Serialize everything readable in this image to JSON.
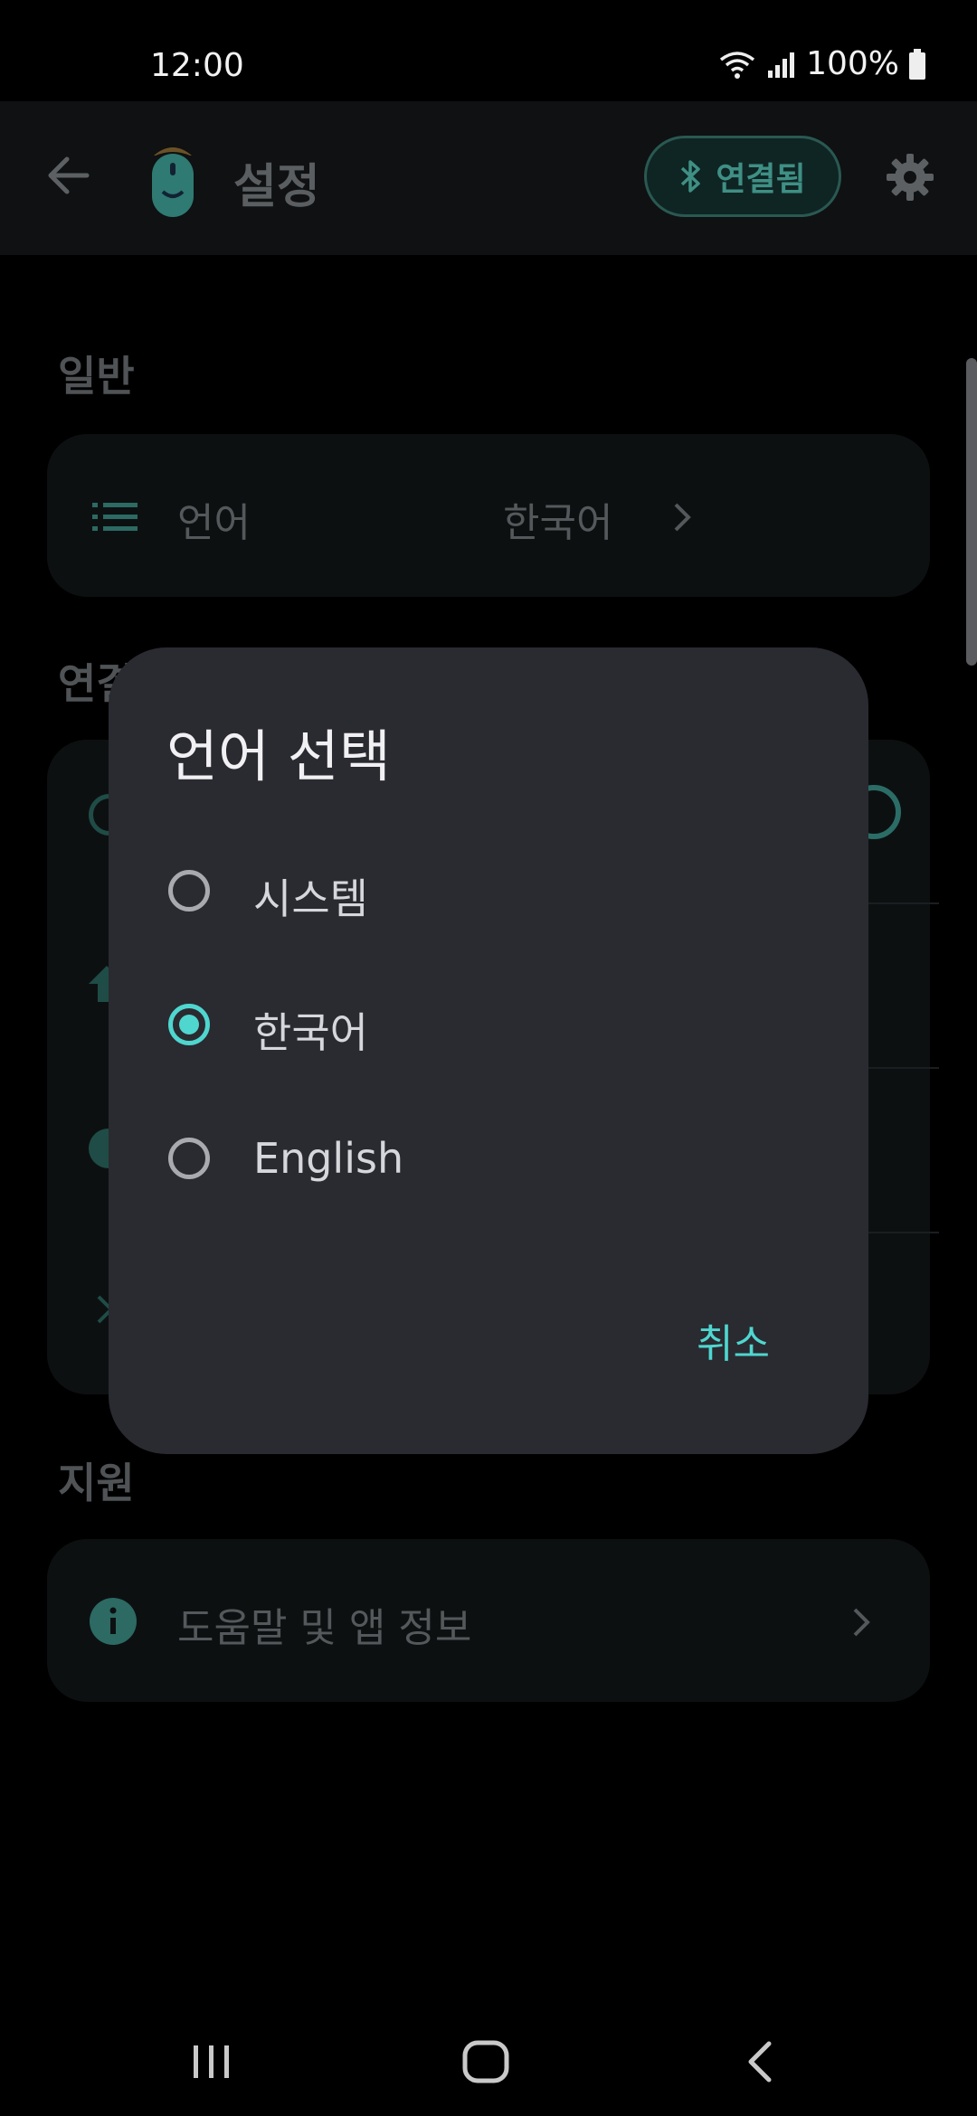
{
  "status_bar": {
    "time": "12:00",
    "battery": "100%"
  },
  "app_bar": {
    "title": "설정",
    "connection_label": "연결됨"
  },
  "sections": {
    "general": {
      "header": "일반",
      "language_label": "언어",
      "language_value": "한국어"
    },
    "connection": {
      "header": "연결"
    },
    "support": {
      "header": "지원",
      "help_label": "도움말 및 앱 정보"
    }
  },
  "dialog": {
    "title": "언어 선택",
    "options": [
      {
        "label": "시스템",
        "selected": false
      },
      {
        "label": "한국어",
        "selected": true
      },
      {
        "label": "English",
        "selected": false
      }
    ],
    "cancel_label": "취소"
  },
  "colors": {
    "accent": "#4fd6cf",
    "dialog_bg": "#2a2a31",
    "screen_bg": "#000000"
  }
}
